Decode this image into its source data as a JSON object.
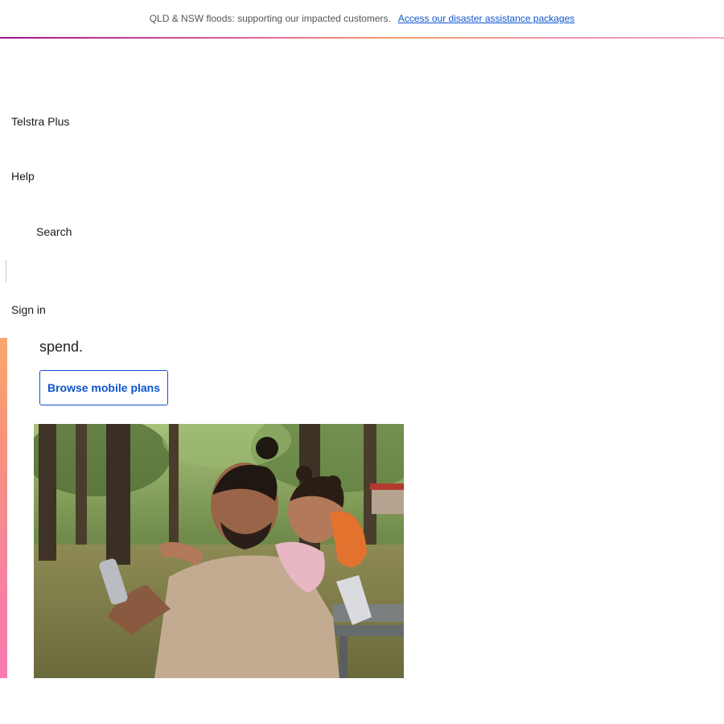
{
  "alert": {
    "message": "QLD & NSW floods: supporting our impacted customers.",
    "link_label": "Access our disaster assistance packages"
  },
  "nav": {
    "telstra_plus": "Telstra Plus",
    "help": "Help",
    "search": "Search",
    "sign_in": "Sign in"
  },
  "hero": {
    "text_fragment": "spend.",
    "cta_label": "Browse mobile plans"
  },
  "colors": {
    "link_blue": "#0d54cf",
    "accent_gradient_start": "#f8a86c",
    "accent_gradient_end": "#f77bb0"
  },
  "icons": {
    "search": "search-icon"
  }
}
